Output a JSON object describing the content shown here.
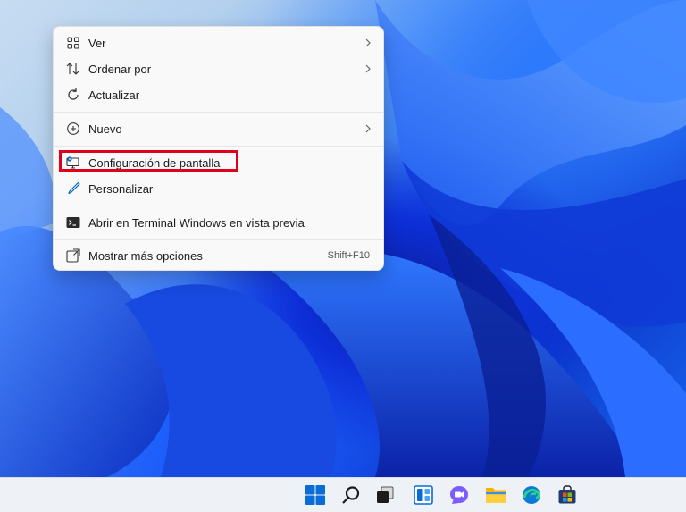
{
  "context_menu": {
    "items": [
      {
        "label": "Ver",
        "icon": "grid-icon",
        "submenu": true
      },
      {
        "label": "Ordenar por",
        "icon": "sort-icon",
        "submenu": true
      },
      {
        "label": "Actualizar",
        "icon": "refresh-icon",
        "submenu": false
      },
      {
        "label": "Nuevo",
        "icon": "plus-circle-icon",
        "submenu": true
      },
      {
        "label": "Configuración de pantalla",
        "icon": "display-settings-icon",
        "submenu": false,
        "highlighted": true
      },
      {
        "label": "Personalizar",
        "icon": "brush-icon",
        "submenu": false
      },
      {
        "label": "Abrir en Terminal Windows en vista previa",
        "icon": "terminal-icon",
        "submenu": false
      },
      {
        "label": "Mostrar más opciones",
        "icon": "expand-icon",
        "submenu": false,
        "shortcut": "Shift+F10"
      }
    ]
  },
  "taskbar": {
    "icons": [
      "start-icon",
      "search-icon",
      "task-view-icon",
      "widgets-icon",
      "chat-icon",
      "file-explorer-icon",
      "edge-icon",
      "store-icon"
    ]
  },
  "colors": {
    "highlight_border": "#e0001b",
    "menu_background": "#f9f9f9",
    "accent": "#0067c0"
  }
}
